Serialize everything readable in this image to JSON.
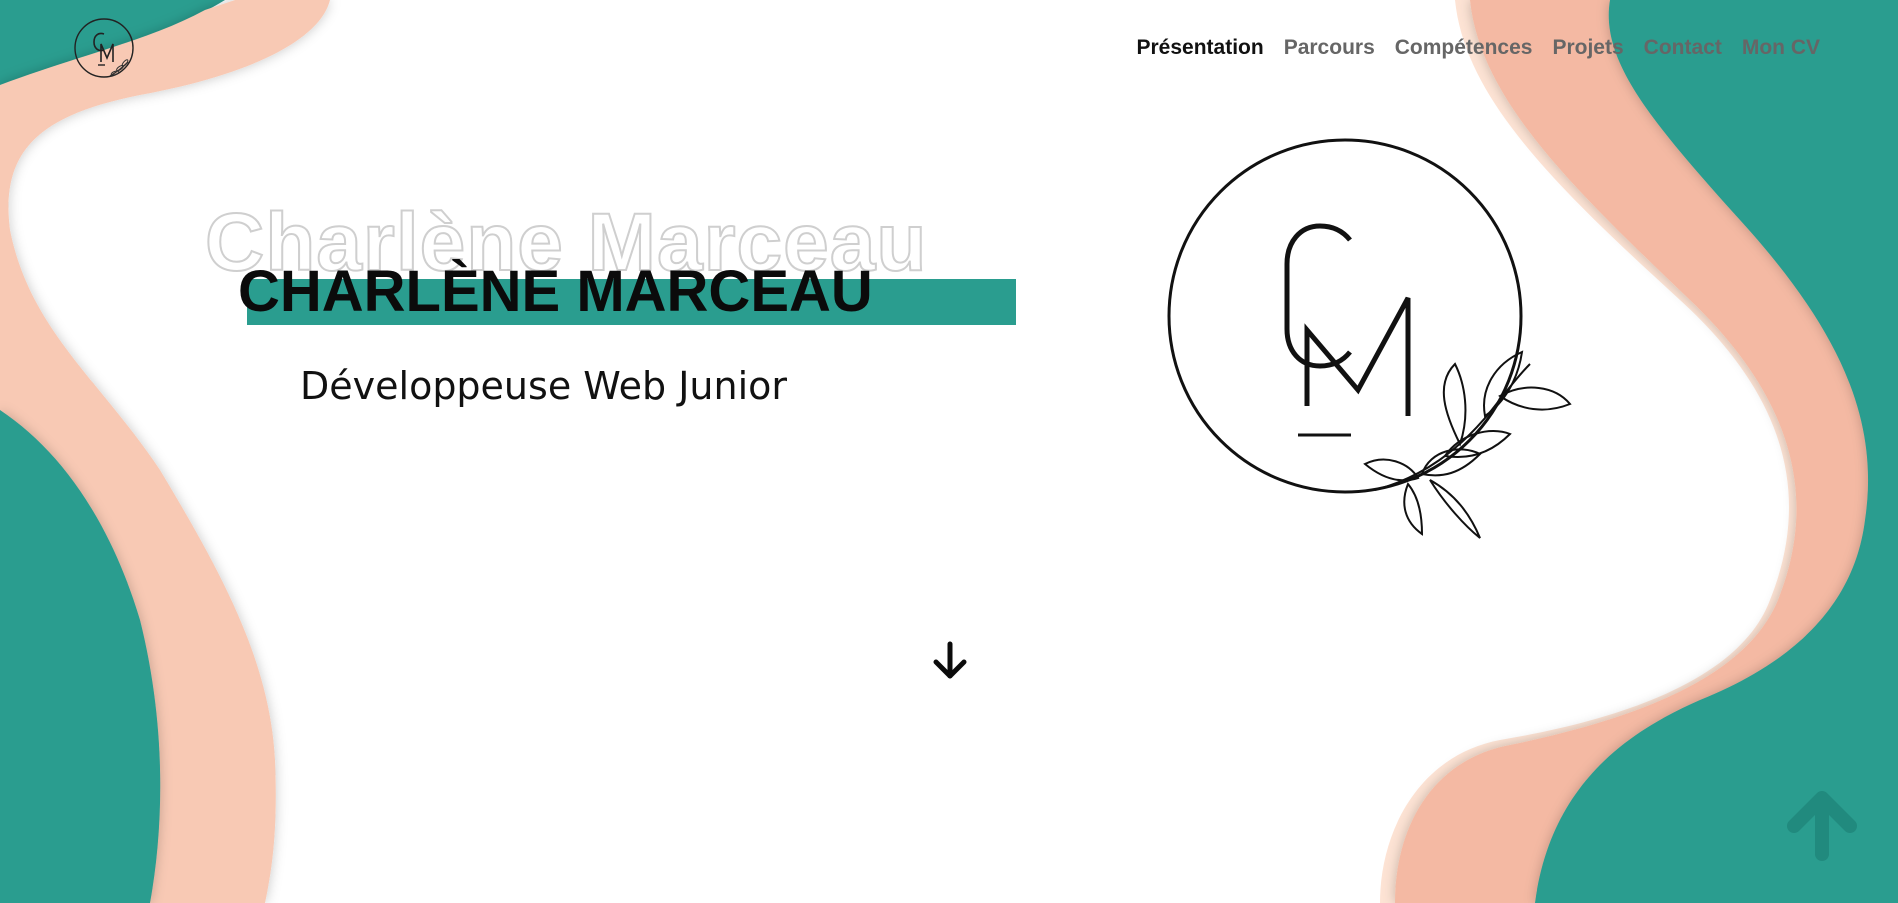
{
  "brand": {
    "logo_text": "CM"
  },
  "nav": {
    "items": [
      {
        "label": "Présentation",
        "active": true
      },
      {
        "label": "Parcours",
        "active": false
      },
      {
        "label": "Compétences",
        "active": false
      },
      {
        "label": "Projets",
        "active": false
      },
      {
        "label": "Contact",
        "active": false
      },
      {
        "label": "Mon CV",
        "active": false
      }
    ]
  },
  "hero": {
    "outline_name": "Charlène Marceau",
    "name": "CHARLÈNE MARCEAU",
    "subtitle": "Développeuse Web Junior"
  },
  "icons": {
    "scroll_down": "arrow-down-icon",
    "back_to_top": "arrow-up-icon"
  },
  "colors": {
    "teal": "#2a9d8f",
    "salmon": "#f4b9a3",
    "peach": "#f8c9b4",
    "cream": "#fde3d4",
    "text": "#111111"
  }
}
